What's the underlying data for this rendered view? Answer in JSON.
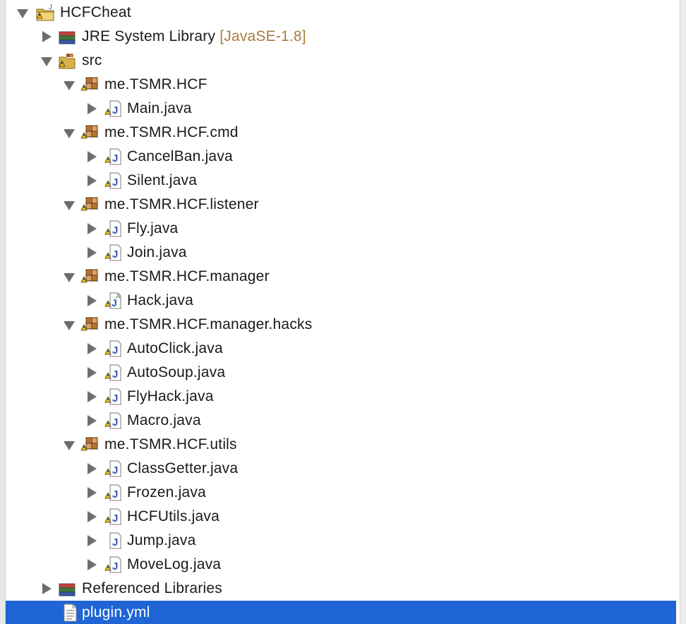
{
  "explorer": {
    "project": {
      "label": "HCFCheat"
    },
    "jre": {
      "label": "JRE System Library",
      "decoration": "[JavaSE-1.8]"
    },
    "src": {
      "label": "src"
    },
    "packages": [
      {
        "label": "me.TSMR.HCF",
        "files": [
          "Main.java"
        ]
      },
      {
        "label": "me.TSMR.HCF.cmd",
        "files": [
          "CancelBan.java",
          "Silent.java"
        ]
      },
      {
        "label": "me.TSMR.HCF.listener",
        "files": [
          "Fly.java",
          "Join.java"
        ]
      },
      {
        "label": "me.TSMR.HCF.manager",
        "files": [
          "Hack.java"
        ]
      },
      {
        "label": "me.TSMR.HCF.manager.hacks",
        "files": [
          "AutoClick.java",
          "AutoSoup.java",
          "FlyHack.java",
          "Macro.java"
        ]
      },
      {
        "label": "me.TSMR.HCF.utils",
        "files": [
          "ClassGetter.java",
          "Frozen.java",
          "HCFUtils.java",
          "Jump.java",
          "MoveLog.java"
        ]
      }
    ],
    "referenced": {
      "label": "Referenced Libraries"
    },
    "plugin": {
      "label": "plugin.yml"
    }
  },
  "colors": {
    "selection": "#1f65d6",
    "decoration": "#a57d3d",
    "twisty": "#6d6d6d"
  },
  "icons": {
    "project": "java-project-icon",
    "library": "library-icon",
    "source_folder": "source-folder-icon",
    "package": "package-icon",
    "java_file": "java-file-icon",
    "abstract_java_file": "abstract-java-file-icon",
    "yml_file": "text-file-icon",
    "warning_overlay": "warning-overlay-icon"
  }
}
